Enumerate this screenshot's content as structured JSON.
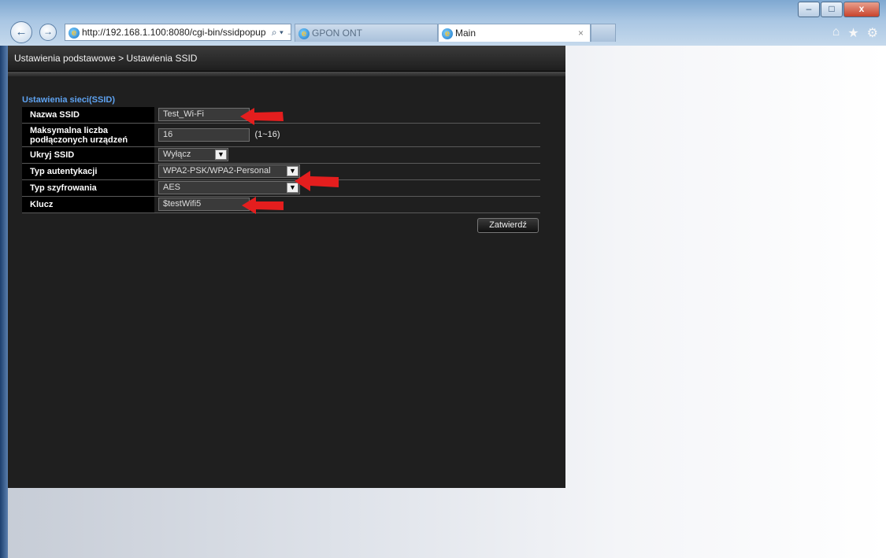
{
  "browser": {
    "address": "http://192.168.1.100:8080/cgi-bin/ssidpopup",
    "address_actions": "⌕ ▾ →",
    "tabs": [
      {
        "label": "GPON ONT"
      },
      {
        "label": "Main",
        "close": "×"
      }
    ],
    "window_controls": [
      "–",
      "□",
      "x"
    ],
    "toolbar_icons": [
      "home-icon",
      "star-icon",
      "gear-icon"
    ]
  },
  "page": {
    "breadcrumb": "Ustawienia podstawowe > Ustawienia SSID",
    "section_title": "Ustawienia sieci(SSID)",
    "fields": {
      "ssid_name": {
        "label": "Nazwa SSID",
        "value": "Test_Wi-Fi"
      },
      "max_devices": {
        "label": "Maksymalna liczba podłączonych urządzeń",
        "value": "16",
        "range": "(1~16)"
      },
      "hide_ssid": {
        "label": "Ukryj SSID",
        "value": "Wyłącz"
      },
      "auth_type": {
        "label": "Typ autentykacji",
        "value": "WPA2-PSK/WPA2-Personal"
      },
      "encryption": {
        "label": "Typ szyfrowania",
        "value": "AES"
      },
      "key": {
        "label": "Klucz",
        "value": "$testWifi5"
      }
    },
    "submit_label": "Zatwierdź"
  },
  "colors": {
    "panel_bg": "#1f1f1f",
    "section_title": "#5ea3f2",
    "annotation_arrow": "#e41e1e"
  },
  "annotations": [
    "arrow-ssid-name",
    "arrow-auth-type",
    "arrow-key"
  ]
}
